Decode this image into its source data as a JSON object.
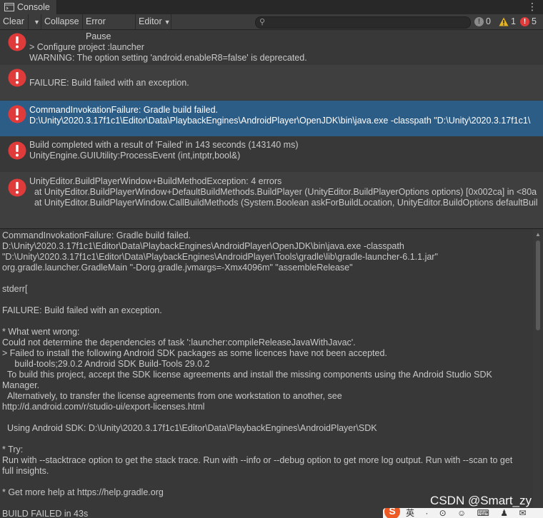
{
  "tab": {
    "title": "Console",
    "menu_glyph": "⋮",
    "icon": "console-icon"
  },
  "toolbar": {
    "clear_label": "Clear",
    "collapse_label": "Collapse",
    "error_pause_label": "Error Pause",
    "editor_label": "Editor",
    "search": {
      "placeholder": ""
    },
    "counts": {
      "info": "0",
      "warning": "1",
      "error": "5"
    }
  },
  "log_entries": [
    {
      "lines": [
        "> Configure project :launcher",
        "WARNING: The option setting 'android.enableR8=false' is deprecated."
      ]
    },
    {
      "lines": [
        "FAILURE: Build failed with an exception."
      ]
    },
    {
      "lines": [
        "CommandInvokationFailure: Gradle build failed.",
        "D:\\Unity\\2020.3.17f1c1\\Editor\\Data\\PlaybackEngines\\AndroidPlayer\\OpenJDK\\bin\\java.exe -classpath \"D:\\Unity\\2020.3.17f1c1\\"
      ]
    },
    {
      "lines": [
        "Build completed with a result of 'Failed' in 143 seconds (143140 ms)",
        "UnityEngine.GUIUtility:ProcessEvent (int,intptr,bool&)"
      ]
    },
    {
      "lines": [
        "UnityEditor.BuildPlayerWindow+BuildMethodException: 4 errors",
        "  at UnityEditor.BuildPlayerWindow+DefaultBuildMethods.BuildPlayer (UnityEditor.BuildPlayerOptions options) [0x002ca] in <80a",
        "  at UnityEditor.BuildPlayerWindow.CallBuildMethods (System.Boolean askForBuildLocation, UnityEditor.BuildOptions defaultBuil"
      ]
    }
  ],
  "detail": {
    "text": "CommandInvokationFailure: Gradle build failed.\nD:\\Unity\\2020.3.17f1c1\\Editor\\Data\\PlaybackEngines\\AndroidPlayer\\OpenJDK\\bin\\java.exe -classpath\n\"D:\\Unity\\2020.3.17f1c1\\Editor\\Data\\PlaybackEngines\\AndroidPlayer\\Tools\\gradle\\lib\\gradle-launcher-6.1.1.jar\"\norg.gradle.launcher.GradleMain \"-Dorg.gradle.jvmargs=-Xmx4096m\" \"assembleRelease\"\n\nstderr[\n\nFAILURE: Build failed with an exception.\n\n* What went wrong:\nCould not determine the dependencies of task ':launcher:compileReleaseJavaWithJavac'.\n> Failed to install the following Android SDK packages as some licences have not been accepted.\n     build-tools;29.0.2 Android SDK Build-Tools 29.0.2\n  To build this project, accept the SDK license agreements and install the missing components using the Android Studio SDK\nManager.\n  Alternatively, to transfer the license agreements from one workstation to another, see\nhttp://d.android.com/r/studio-ui/export-licenses.html\n\n  Using Android SDK: D:\\Unity\\2020.3.17f1c1\\Editor\\Data\\PlaybackEngines\\AndroidPlayer\\SDK\n\n* Try:\nRun with --stacktrace option to get the stack trace. Run with --info or --debug option to get more log output. Run with --scan to get\nfull insights.\n\n* Get more help at https://help.gradle.org\n\nBUILD FAILED in 43s"
  },
  "watermark": "CSDN @Smart_zy",
  "ime_bar": {
    "logo": "S",
    "items": "英 · ⊙ ☺ ⌨ ♟ ✉ 👕 ⊞"
  },
  "colors": {
    "selected_row": "#2c5d87",
    "error_icon": "#e03b3b",
    "warning_icon": "#e6b422",
    "info_icon": "#8a8a8a"
  }
}
